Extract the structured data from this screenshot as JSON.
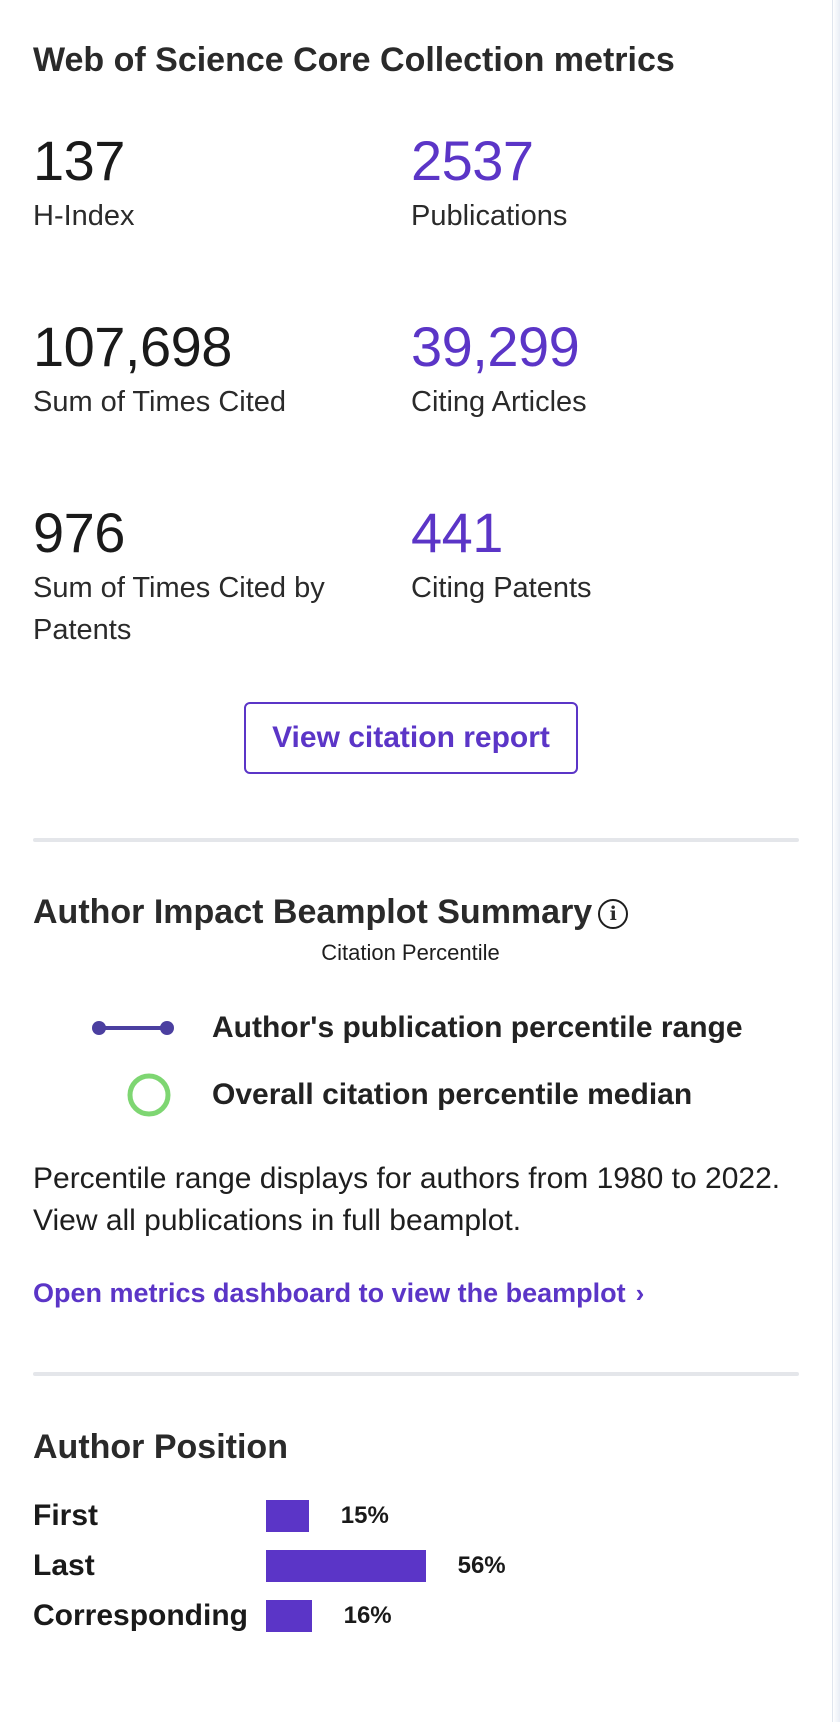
{
  "core_metrics": {
    "title": "Web of Science Core Collection metrics",
    "items": [
      {
        "value": "137",
        "label": "H-Index"
      },
      {
        "value": "2537",
        "label": "Publications"
      },
      {
        "value": "107,698",
        "label": "Sum of Times Cited"
      },
      {
        "value": "39,299",
        "label": "Citing Articles"
      },
      {
        "value": "976",
        "label": "Sum of Times Cited by Patents"
      },
      {
        "value": "441",
        "label": "Citing Patents"
      }
    ],
    "button_label": "View citation report"
  },
  "beamplot": {
    "title": "Author Impact Beamplot Summary",
    "info_icon": "info-circle-icon",
    "subcaption": "Citation Percentile",
    "legend": [
      {
        "label": "Author's publication percentile range",
        "icon": "range-line-icon"
      },
      {
        "label": "Overall citation percentile median",
        "icon": "median-circle-icon"
      }
    ],
    "description": "Percentile range displays for authors from 1980 to 2022. View all publications in full beamplot.",
    "link_label": "Open metrics dashboard to view the beamplot",
    "link_icon": "chevron-right-icon"
  },
  "author_position": {
    "title": "Author Position",
    "rows": [
      {
        "label": "First",
        "percent": 15,
        "percent_label": "15%"
      },
      {
        "label": "Last",
        "percent": 56,
        "percent_label": "56%"
      },
      {
        "label": "Corresponding",
        "percent": 16,
        "percent_label": "16%"
      }
    ]
  },
  "colors": {
    "accent": "#5b35c7",
    "median_ring": "#7ed672",
    "range_line": "#4b3fa0",
    "divider": "#e4e6ea"
  }
}
